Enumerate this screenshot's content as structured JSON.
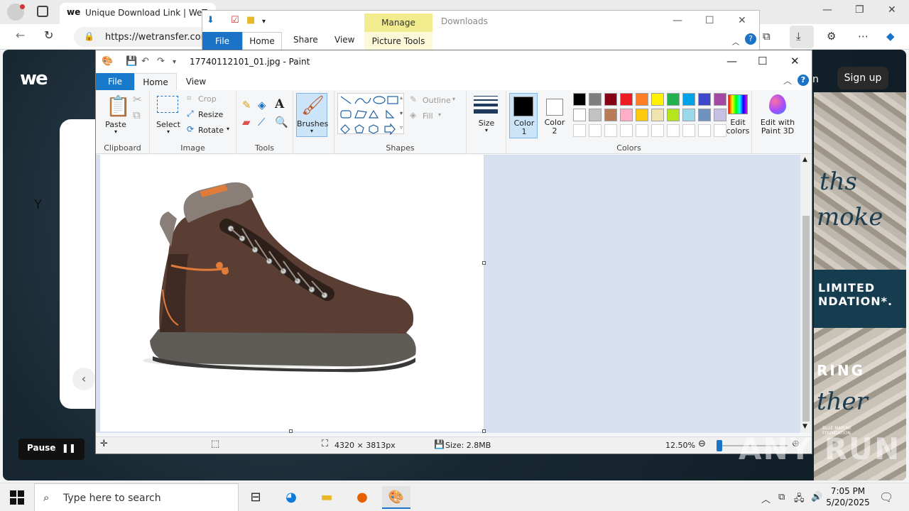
{
  "browser": {
    "tab_logo": "we",
    "tab_title": "Unique Download Link | WeTransfer",
    "url": "https://wetransfer.com"
  },
  "webpage": {
    "logo": "we",
    "card_text": "Y",
    "pause_label": "Pause",
    "signin_label": "n",
    "signup_label": "Sign up",
    "ad_script_1": "ths",
    "ad_script_2": "moke",
    "ad_band_line1": "LIMITED",
    "ad_band_line2": "NDATION*.",
    "ad_ring": "RING",
    "ad_script_3": "ther",
    "ad_foundation": "BLUE MARINE FOUNDATION"
  },
  "explorer": {
    "manage_label": "Manage",
    "title": "Downloads",
    "tabs": {
      "file": "File",
      "home": "Home",
      "share": "Share",
      "view": "View",
      "picture_tools": "Picture Tools"
    }
  },
  "paint": {
    "title": "17740112101_01.jpg - Paint",
    "tabs": {
      "file": "File",
      "home": "Home",
      "view": "View"
    },
    "groups": {
      "clipboard": "Clipboard",
      "image": "Image",
      "tools": "Tools",
      "shapes": "Shapes",
      "colors": "Colors"
    },
    "buttons": {
      "paste": "Paste",
      "select": "Select",
      "crop": "Crop",
      "resize": "Resize",
      "rotate": "Rotate",
      "brushes": "Brushes",
      "outline": "Outline",
      "fill": "Fill",
      "size": "Size",
      "color1_line1": "Color",
      "color1_line2": "1",
      "color2_line1": "Color",
      "color2_line2": "2",
      "edit_colors_line1": "Edit",
      "edit_colors_line2": "colors",
      "paint3d_line1": "Edit with",
      "paint3d_line2": "Paint 3D"
    },
    "color1": "#000000",
    "color2": "#ffffff",
    "palette": [
      "#000000",
      "#7f7f7f",
      "#880015",
      "#ed1c24",
      "#ff7f27",
      "#fff200",
      "#22b14c",
      "#00a2e8",
      "#3f48cc",
      "#a349a4",
      "#ffffff",
      "#c3c3c3",
      "#b97a57",
      "#ffaec9",
      "#ffc90e",
      "#efe4b0",
      "#b5e61d",
      "#99d9ea",
      "#7092be",
      "#c8bfe7"
    ],
    "status": {
      "dimensions": "4320 × 3813px",
      "size": "Size: 2.8MB",
      "zoom": "12.50%"
    }
  },
  "taskbar": {
    "search_placeholder": "Type here to search",
    "time": "7:05 PM",
    "date": "5/20/2025"
  },
  "watermark": "ANY RUN"
}
